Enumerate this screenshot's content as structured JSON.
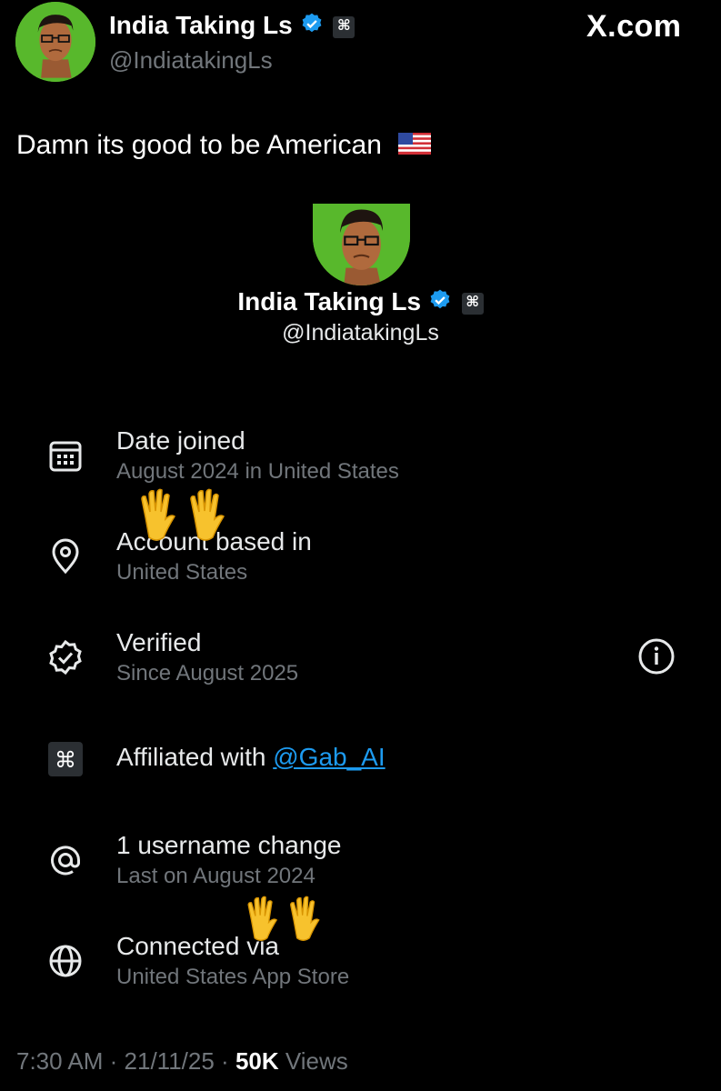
{
  "header": {
    "name": "India Taking Ls",
    "handle": "@IndiatakingLs",
    "brand": "X.com"
  },
  "tweet": {
    "text": "Damn its good to be American"
  },
  "card": {
    "name": "India Taking Ls",
    "handle": "@IndiatakingLs"
  },
  "about_rows": [
    {
      "icon": "calendar-icon",
      "title": "Date joined",
      "subtitle": "August 2024 in United States"
    },
    {
      "icon": "location-pin-icon",
      "title": "Account based in",
      "subtitle": "United States"
    },
    {
      "icon": "verified-badge-icon",
      "title": "Verified",
      "subtitle": "Since August 2025"
    },
    {
      "icon": "affiliate-icon",
      "title_prefix": "Affiliated with",
      "title_link": "@Gab_AI"
    },
    {
      "icon": "at-sign-icon",
      "title": "1 username change",
      "subtitle": "Last on August 2024"
    },
    {
      "icon": "globe-icon",
      "title": "Connected via",
      "subtitle": "United States App Store"
    }
  ],
  "footer": {
    "time": "7:30 AM",
    "date": "21/11/25",
    "views_count": "50K",
    "views_label": "Views"
  },
  "colors": {
    "background": "#000000",
    "avatar_green": "#58b82c",
    "verified_blue": "#1d9bf0",
    "link_blue": "#1d9bf0",
    "muted_text": "#71767b"
  }
}
